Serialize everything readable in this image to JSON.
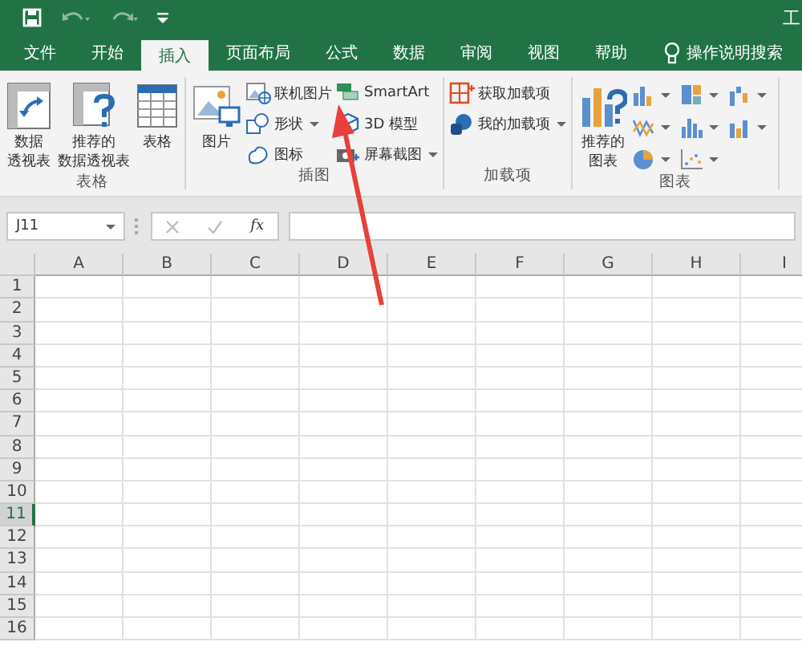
{
  "window": {
    "title": "工"
  },
  "tabs": [
    {
      "label": "文件",
      "selected": false
    },
    {
      "label": "开始",
      "selected": false
    },
    {
      "label": "插入",
      "selected": true
    },
    {
      "label": "页面布局",
      "selected": false
    },
    {
      "label": "公式",
      "selected": false
    },
    {
      "label": "数据",
      "selected": false
    },
    {
      "label": "审阅",
      "selected": false
    },
    {
      "label": "视图",
      "selected": false
    },
    {
      "label": "帮助",
      "selected": false
    }
  ],
  "tell_me": {
    "label": "操作说明搜索"
  },
  "ribbon": [
    {
      "label": "表格",
      "items": [
        {
          "kind": "large",
          "lines": [
            "数据",
            "透视表"
          ]
        },
        {
          "kind": "large",
          "lines": [
            "推荐的",
            "数据透视表"
          ]
        },
        {
          "kind": "large",
          "lines": [
            "表格"
          ]
        }
      ]
    },
    {
      "label": "插图",
      "items": [
        {
          "kind": "large",
          "lines": [
            "图片"
          ]
        },
        {
          "kind": "column",
          "items": [
            {
              "label": "联机图片",
              "dropdown": false
            },
            {
              "label": "形状",
              "dropdown": true
            },
            {
              "label": "图标",
              "dropdown": false
            }
          ]
        },
        {
          "kind": "column",
          "items": [
            {
              "label": "SmartArt",
              "dropdown": false
            },
            {
              "label": "3D 模型",
              "dropdown": false
            },
            {
              "label": "屏幕截图",
              "dropdown": true
            }
          ]
        }
      ]
    },
    {
      "label": "加载项",
      "items": [
        {
          "kind": "column",
          "items": [
            {
              "label": "获取加载项",
              "dropdown": false
            },
            {
              "label": "我的加载项",
              "dropdown": true
            }
          ]
        }
      ]
    },
    {
      "label": "图表",
      "items": [
        {
          "kind": "large",
          "lines": [
            "推荐的",
            "图表"
          ]
        },
        {
          "kind": "charts"
        }
      ]
    }
  ],
  "formula_bar": {
    "name_box": "J11",
    "fx": "fx"
  },
  "columns": [
    "A",
    "B",
    "C",
    "D",
    "E",
    "F",
    "G",
    "H",
    "I"
  ],
  "rows": [
    {
      "label": "1",
      "selected": false
    },
    {
      "label": "2",
      "selected": false
    },
    {
      "label": "3",
      "selected": false
    },
    {
      "label": "4",
      "selected": false
    },
    {
      "label": "5",
      "selected": false
    },
    {
      "label": "6",
      "selected": false
    },
    {
      "label": "7",
      "selected": false
    },
    {
      "label": "8",
      "selected": false
    },
    {
      "label": "9",
      "selected": false
    },
    {
      "label": "10",
      "selected": false
    },
    {
      "label": "11",
      "selected": true
    },
    {
      "label": "12",
      "selected": false
    },
    {
      "label": "13",
      "selected": false
    },
    {
      "label": "14",
      "selected": false
    },
    {
      "label": "15",
      "selected": false
    },
    {
      "label": "16",
      "selected": false
    }
  ]
}
